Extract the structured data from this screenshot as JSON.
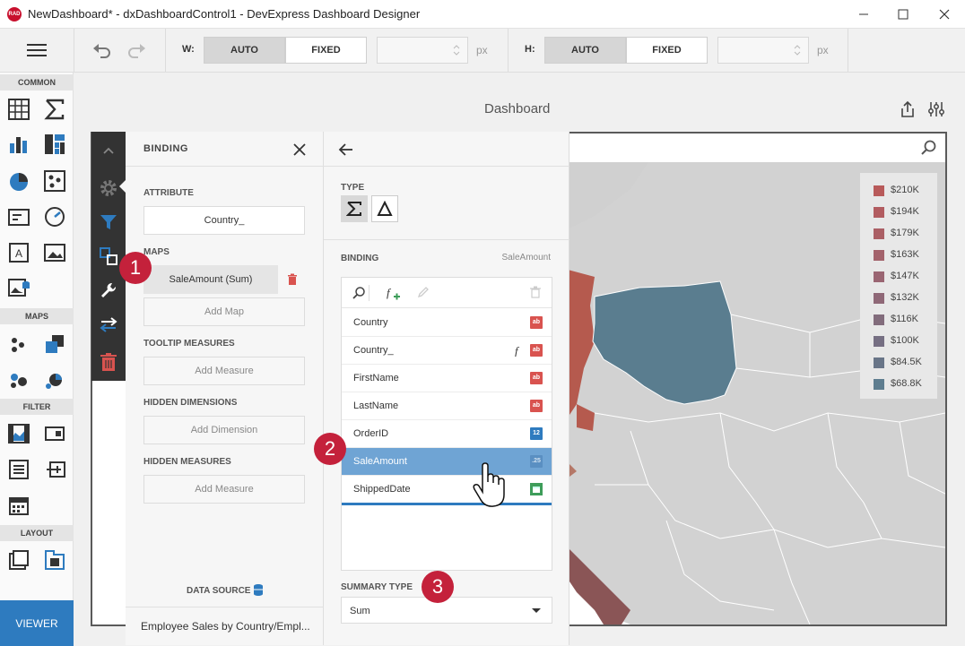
{
  "window": {
    "title": "NewDashboard* - dxDashboardControl1 - DevExpress Dashboard Designer",
    "logo_text": "RAD"
  },
  "toolbar": {
    "width_label": "W:",
    "height_label": "H:",
    "auto_label": "AUTO",
    "fixed_label": "FIXED",
    "unit": "px",
    "width_mode": "AUTO",
    "height_mode": "AUTO"
  },
  "toolbox": {
    "sections": [
      "COMMON",
      "MAPS",
      "FILTER",
      "LAYOUT"
    ],
    "viewer_label": "VIEWER"
  },
  "dashboard": {
    "title": "Dashboard"
  },
  "binding_panel": {
    "header": "BINDING",
    "attribute_label": "ATTRIBUTE",
    "attribute_value": "Country_",
    "maps_label": "MAPS",
    "maps_value": "SaleAmount (Sum)",
    "add_map": "Add Map",
    "tooltip_measures_label": "TOOLTIP MEASURES",
    "add_measure_1": "Add Measure",
    "hidden_dimensions_label": "HIDDEN DIMENSIONS",
    "add_dimension": "Add Dimension",
    "hidden_measures_label": "HIDDEN MEASURES",
    "add_measure_2": "Add Measure",
    "data_source_label": "DATA SOURCE",
    "data_source_value": "Employee Sales by Country/Empl..."
  },
  "detail_panel": {
    "type_label": "TYPE",
    "binding_label": "BINDING",
    "binding_value": "SaleAmount",
    "fields": [
      {
        "name": "Country",
        "type": "ab"
      },
      {
        "name": "Country_",
        "type": "ab"
      },
      {
        "name": "FirstName",
        "type": "ab"
      },
      {
        "name": "LastName",
        "type": "ab"
      },
      {
        "name": "OrderID",
        "type": "12"
      },
      {
        "name": "SaleAmount",
        "type": ".25"
      },
      {
        "name": "ShippedDate",
        "type": "date"
      }
    ],
    "selected_field": "SaleAmount",
    "summary_type_label": "SUMMARY TYPE",
    "summary_type_value": "Sum"
  },
  "legend": {
    "items": [
      {
        "label": "$210K",
        "color": "#b85a5a"
      },
      {
        "label": "$194K",
        "color": "#b25c60"
      },
      {
        "label": "$179K",
        "color": "#ab5f65"
      },
      {
        "label": "$163K",
        "color": "#a3626b"
      },
      {
        "label": "$147K",
        "color": "#9a6572"
      },
      {
        "label": "$132K",
        "color": "#8f6877"
      },
      {
        "label": "$116K",
        "color": "#826c7c"
      },
      {
        "label": "$100K",
        "color": "#766f83"
      },
      {
        "label": "$84.5K",
        "color": "#697588"
      },
      {
        "label": "$68.8K",
        "color": "#5e7d8f"
      }
    ]
  },
  "callouts": [
    "1",
    "2",
    "3"
  ],
  "colors": {
    "accent": "#2e7bbf",
    "selection": "#6fa4d4",
    "callout": "#c4213b",
    "map_land": "#d2d2d2",
    "poland": "#5a7d8f",
    "germany": "#b55a4e",
    "italy": "#8a5556"
  }
}
